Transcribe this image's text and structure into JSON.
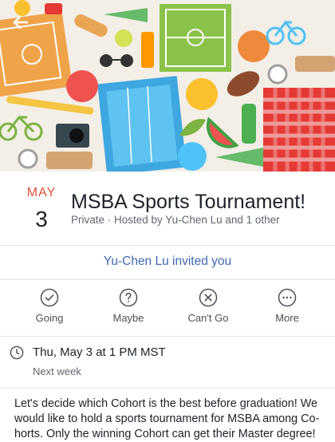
{
  "event": {
    "month": "MAY",
    "day": "3",
    "title": "MSBA Sports Tournament!",
    "subtitle": "Private · Hosted by Yu-Chen Lu and 1 other"
  },
  "invite_text": "Yu-Chen Lu invited you",
  "actions": [
    {
      "label": "Going",
      "icon": "check-circle-icon"
    },
    {
      "label": "Maybe",
      "icon": "question-circle-icon"
    },
    {
      "label": "Can't Go",
      "icon": "x-circle-icon"
    },
    {
      "label": "More",
      "icon": "more-dots-icon"
    }
  ],
  "time": {
    "main": "Thu, May 3 at 1 PM MST",
    "relative": "Next week"
  },
  "description": "Let's decide which Cohort is the best before graduation! We would like to hold a sports tournament for MSBA among Co-horts. Only the winning Cohort can get their Master degree!",
  "colors": {
    "accent_red": "#e0503c",
    "link_blue": "#4267b2",
    "icon_gray": "#4b4f56"
  }
}
